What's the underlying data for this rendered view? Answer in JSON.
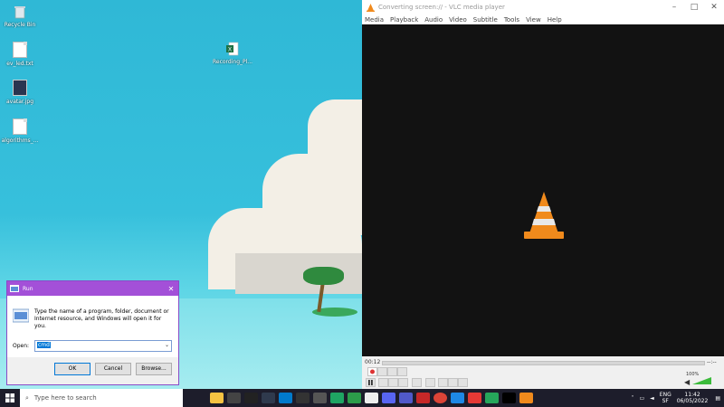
{
  "desktop": {
    "icons": [
      {
        "label": "Recycle Bin",
        "icon": "recycle-bin-icon"
      },
      {
        "label": "ev_led.txt",
        "icon": "text-file-icon"
      },
      {
        "label": "avatar.jpg",
        "icon": "image-file-icon"
      },
      {
        "label": "algorithms_...",
        "icon": "text-file-icon"
      },
      {
        "label": "Recording_Pl...",
        "icon": "excel-file-icon"
      }
    ]
  },
  "vlc": {
    "title": "Converting screen:// - VLC media player",
    "menu": [
      "Media",
      "Playback",
      "Audio",
      "Video",
      "Subtitle",
      "Tools",
      "View",
      "Help"
    ],
    "elapsed": "00:12",
    "remaining": "--:--",
    "volume": "100%",
    "colors": {
      "cone_orange": "#f08a1c",
      "video_bg": "#121212"
    }
  },
  "run": {
    "title": "Run",
    "description": "Type the name of a program, folder, document or Internet resource, and Windows will open it for you.",
    "open_label": "Open:",
    "open_value": "cmd",
    "ok": "OK",
    "cancel": "Cancel",
    "browse": "Browse...",
    "colors": {
      "title_bar": "#a350d8"
    }
  },
  "taskbar": {
    "search_placeholder": "Type here to search",
    "lang": "ENG",
    "lang_sub": "SF",
    "time": "11:42",
    "date": "06/05/2022"
  }
}
